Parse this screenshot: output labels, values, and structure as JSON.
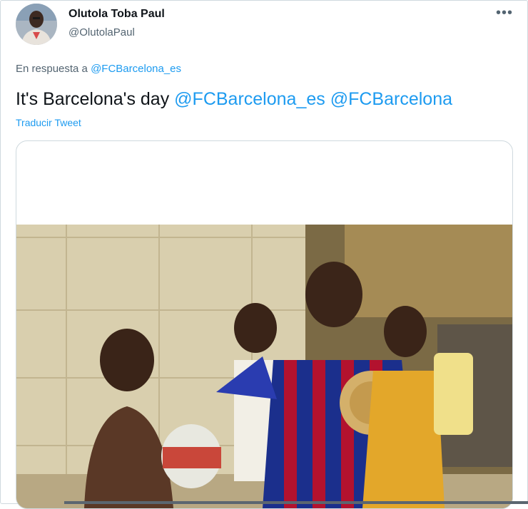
{
  "author": {
    "name": "Olutola Toba Paul",
    "handle": "@OlutolaPaul"
  },
  "more_icon": "more-horizontal-icon",
  "reply": {
    "prefix": "En respuesta a",
    "mention": "@FCBarcelona_es"
  },
  "tweet": {
    "text": "It's Barcelona's day",
    "mentions": [
      "@FCBarcelona_es",
      "@FCBarcelona"
    ]
  },
  "translate_label": "Traducir Tweet",
  "colors": {
    "link": "#1d9bf0",
    "text": "#0f1419",
    "muted": "#536471",
    "shirt_blue": "#1b2f8c",
    "shirt_red": "#b3122e"
  }
}
